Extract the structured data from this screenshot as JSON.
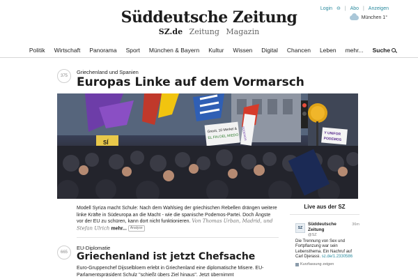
{
  "header": {
    "login_label": "Login",
    "abo_label": "Abo",
    "ads_label": "Anzeigen",
    "separator": "|",
    "weather_icon": "cloud-icon",
    "weather_text": "München 1°",
    "logo": "Süddeutsche Zeitung",
    "subnav": [
      "SZ.de",
      "Zeitung",
      "Magazin"
    ]
  },
  "nav": {
    "items": [
      "Politik",
      "Wirtschaft",
      "Panorama",
      "Sport",
      "München & Bayern",
      "Kultur",
      "Wissen",
      "Digital",
      "Chancen",
      "Leben",
      "mehr..."
    ],
    "search_label": "Suche",
    "search_icon": "search-icon"
  },
  "article1": {
    "counter": "375",
    "kicker": "Griechenland und Spanien",
    "headline": "Europas Linke auf dem Vormarsch",
    "teaser": "Modell Syriza macht Schule: Nach dem Wahlsieg der griechischen Rebellen drängen weitere linke Kräfte in Südeuropa an die Macht - wie die spanische Podemos-Partei. Doch Ängste vor der EU zu schüren, kann dort nicht funktionieren.",
    "byline": "Von Thomas Urban, Madrid, und Stefan Ulrich",
    "more": "mehr...",
    "badge": "Analyse",
    "photo_signs": [
      "Grexit, 10 Merkel &",
      "EL FIN DEL MIEDO",
      "SÍ",
      "PODEMOS",
      "Y UNIFOR",
      "PODEMOS"
    ]
  },
  "article2": {
    "counter": "665",
    "kicker": "EU-Diplomatie",
    "headline": "Griechenland ist jetzt Chefsache",
    "teaser": "Euro-Gruppenchef Dijsselbloem erlebt in Griechenland eine diplomatische Misere. EU-Parlamentspräsident Schulz \"schießt übers Ziel hinaus\". Jetzt übernimmt"
  },
  "sidebar": {
    "title": "Live aus der SZ",
    "tweet": {
      "avatar": "SZ",
      "name": "Süddeutsche Zeitung",
      "handle": "@SZ",
      "time": "36m",
      "body": "Die Trennung von Sex und Fortpflanzung war sein Lebensthema. Ein Nachruf auf Carl Djerassi.",
      "link": "sz.de/1.2330586",
      "summary": "Kurzfassung zeigen"
    }
  },
  "colors": {
    "accent": "#2a8a9e",
    "text": "#1d1d1d"
  }
}
